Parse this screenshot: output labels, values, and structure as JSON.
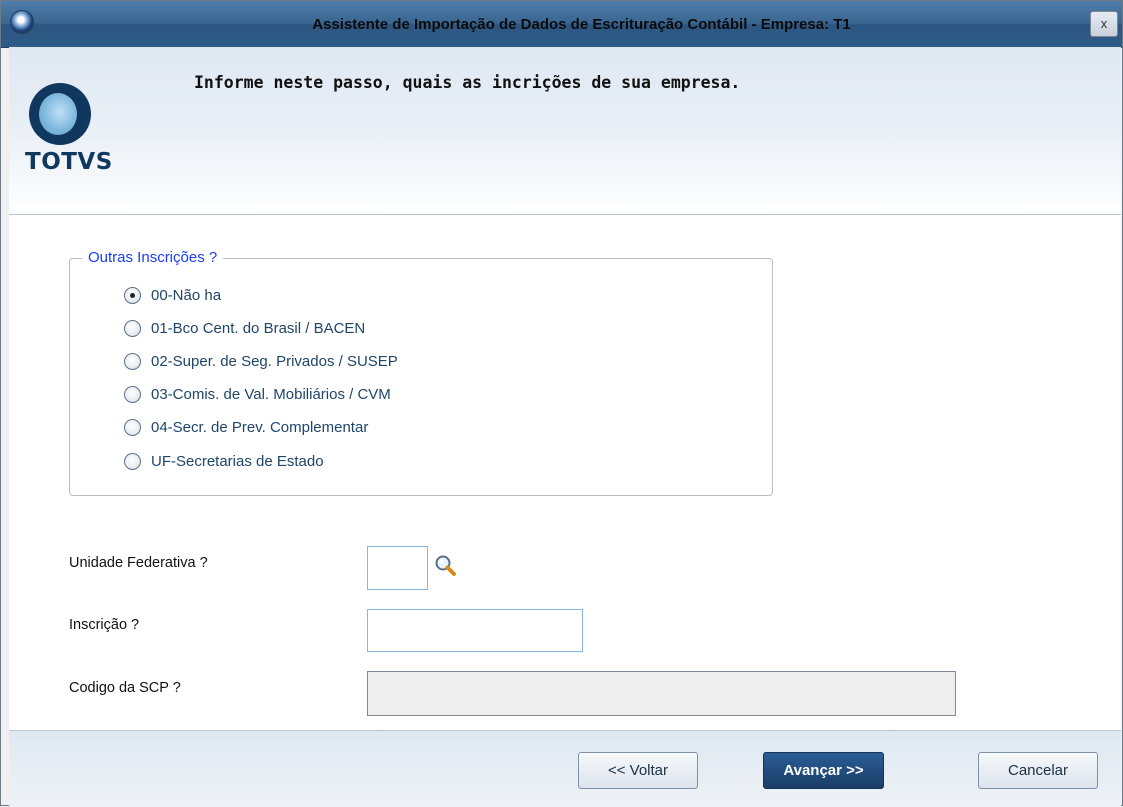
{
  "window": {
    "title": "Assistente de Importação de Dados de Escrituração Contábil - Empresa: T1",
    "close_label": "x"
  },
  "header": {
    "title": "Informe neste passo, quais as incrições de sua empresa.",
    "logo_text": "TOTVS"
  },
  "group": {
    "legend": "Outras Inscrições ?",
    "options": [
      {
        "label": "00-Não ha",
        "checked": true
      },
      {
        "label": "01-Bco Cent. do Brasil / BACEN",
        "checked": false
      },
      {
        "label": "02-Super. de Seg. Privados / SUSEP",
        "checked": false
      },
      {
        "label": "03-Comis. de Val. Mobiliários / CVM",
        "checked": false
      },
      {
        "label": "04-Secr. de Prev. Complementar",
        "checked": false
      },
      {
        "label": "UF-Secretarias de Estado",
        "checked": false
      }
    ]
  },
  "fields": {
    "uf_label": "Unidade Federativa ?",
    "uf_value": "",
    "inscricao_label": "Inscrição ?",
    "inscricao_value": "",
    "scp_label": "Codigo da SCP ?",
    "scp_value": ""
  },
  "footer": {
    "back_label": "<< Voltar",
    "next_label": "Avançar >>",
    "cancel_label": "Cancelar"
  },
  "icons": {
    "app": "totvs-app-icon",
    "lookup": "magnifier-icon",
    "close": "close-icon"
  }
}
